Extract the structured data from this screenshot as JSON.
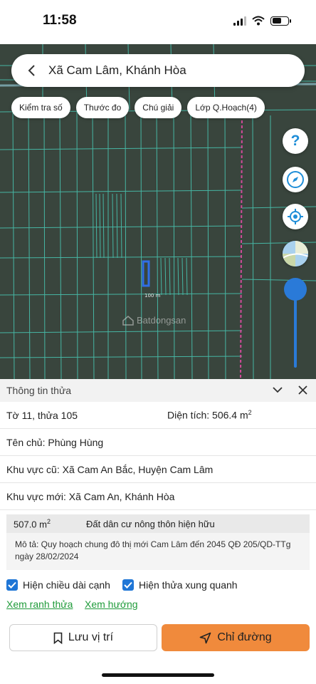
{
  "status": {
    "time": "11:58"
  },
  "header": {
    "title": "Xã Cam Lâm, Khánh Hòa"
  },
  "chips": [
    "Kiểm tra số",
    "Thước đo",
    "Chú giải",
    "Lớp Q.Hoạch(4)"
  ],
  "map": {
    "watermark": "Batdongsan",
    "parcel_measure": "100 m",
    "colors": {
      "background": "#39453d",
      "lines": "#49c9b5",
      "highlight": "#2f6ee6",
      "road": "#d24a9a"
    }
  },
  "panel": {
    "title": "Thông tin thửa",
    "sheet_parcel": "Tờ 11, thửa 105",
    "area_label": "Diện tích: 506.4 m",
    "area_sup": "2",
    "owner": "Tên chủ: Phùng Hùng",
    "old_area": "Khu vực cũ: Xã Cam An Bắc, Huyện Cam Lâm",
    "new_area": "Khu vực mới: Xã Cam An, Khánh Hòa",
    "zone": {
      "area": "507.0 m",
      "area_sup": "2",
      "type": "Đất dân cư nông thôn hiện hữu",
      "description": "Mô tả: Quy hoạch chung đô thị mới Cam Lâm đến 2045 QĐ 205/QD-TTg ngày 28/02/2024"
    },
    "checkbox_edges": "Hiện chiều dài cạnh",
    "checkbox_neighbors": "Hiện thửa xung quanh",
    "link_boundary": "Xem ranh thửa",
    "link_direction": "Xem hướng",
    "btn_save": "Lưu vị trí",
    "btn_directions": "Chỉ đường"
  },
  "colors": {
    "accent_blue": "#1f76d6",
    "orange": "#f08a3c",
    "link_green": "#1f9b3a"
  }
}
